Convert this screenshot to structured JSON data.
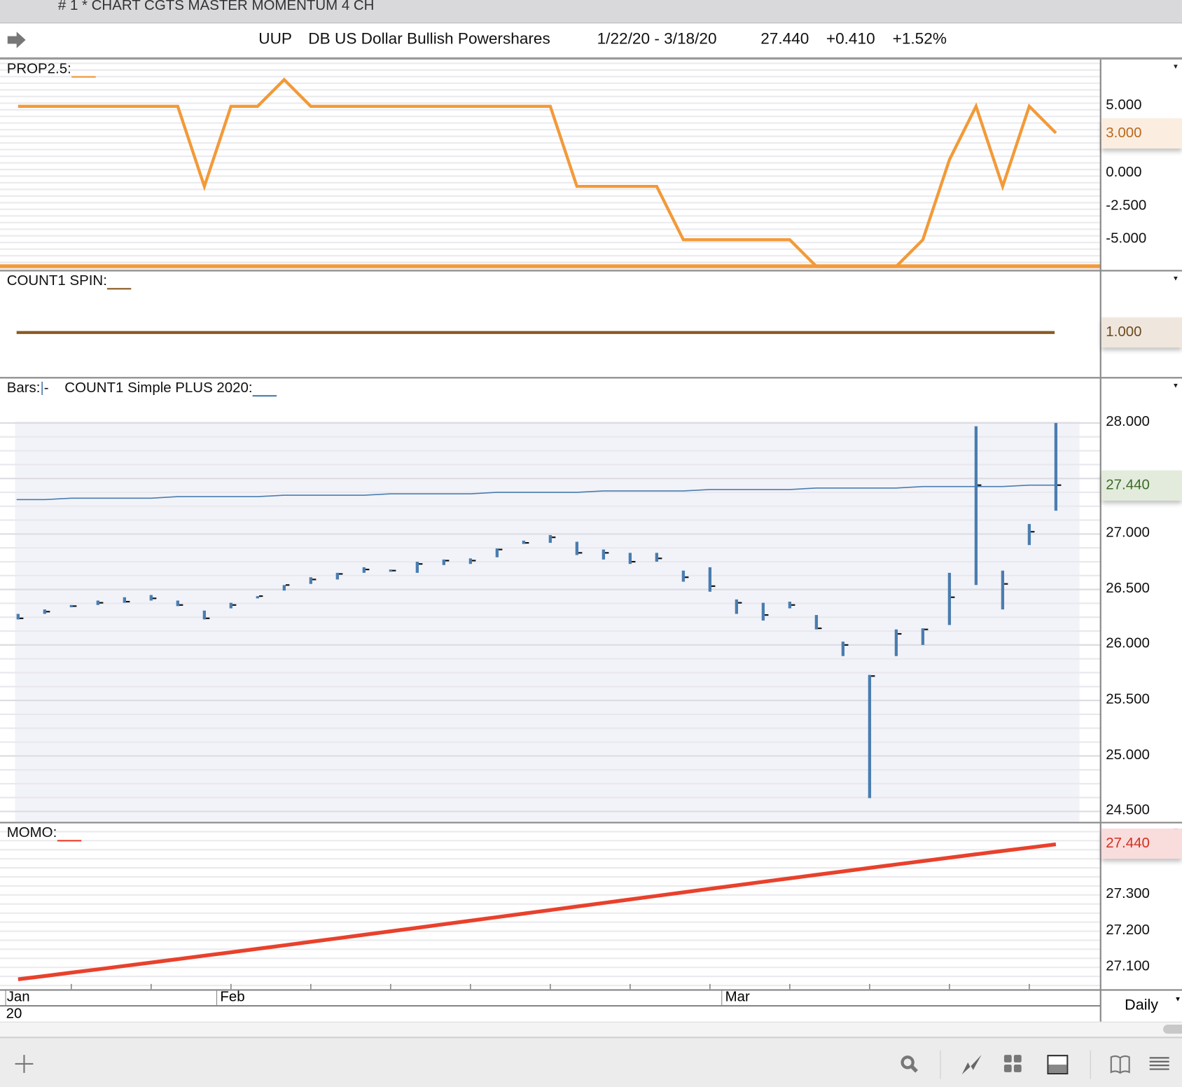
{
  "window_title": "# 1 * CHART CGTS MASTER MOMENTUM 4 CH",
  "header": {
    "symbol": "UUP",
    "name": "DB US Dollar Bullish Powershares",
    "date_range": "1/22/20 - 3/18/20",
    "last": "27.440",
    "change": "+0.410",
    "change_pct": "+1.52%"
  },
  "colors": {
    "prop": "#f29a38",
    "spin": "#8a5a25",
    "bars": "#4a7db0",
    "ma": "#4a7db0",
    "momo": "#e8412c"
  },
  "panels": {
    "prop": {
      "label": "PROP2.5:",
      "current": "3.000"
    },
    "spin": {
      "label": "COUNT1 SPIN:",
      "current": "1.000"
    },
    "bars": {
      "label": "Bars:",
      "label2": "COUNT1 Simple PLUS 2020:",
      "current": "27.440"
    },
    "momo": {
      "label": "MOMO:",
      "current": "27.440"
    }
  },
  "xaxis": {
    "months": [
      "Jan",
      "Feb",
      "Mar"
    ],
    "year": "20",
    "period": "Daily"
  },
  "chart_data": [
    {
      "type": "line",
      "title": "PROP2.5",
      "yticks": [
        "5.000",
        "0.000",
        "-2.500",
        "-5.000"
      ],
      "ytick_values": [
        5,
        0,
        -2.5,
        -5
      ],
      "ylim": [
        -7,
        8.4
      ],
      "values": [
        5,
        5,
        5,
        5,
        5,
        5,
        5,
        -1,
        5,
        5,
        7,
        5,
        5,
        5,
        5,
        5,
        5,
        5,
        5,
        5,
        5,
        -1,
        -1,
        -1,
        -1,
        -5,
        -5,
        -5,
        -5,
        -5,
        -7,
        -7,
        -7,
        -7,
        -5,
        1,
        5,
        -1,
        5,
        3
      ]
    },
    {
      "type": "line",
      "title": "COUNT1 SPIN",
      "values_constant": 1.0,
      "count": 40
    },
    {
      "type": "ohlc",
      "title": "UUP Daily Bars",
      "yticks": [
        "28.000",
        "27.000",
        "26.500",
        "26.000",
        "25.500",
        "25.000",
        "24.500"
      ],
      "ytick_values": [
        28,
        27,
        26.5,
        26,
        25.5,
        25,
        24.5
      ],
      "ylim": [
        24.45,
        28.4
      ],
      "high": [
        26.28,
        26.32,
        26.36,
        26.4,
        26.43,
        26.45,
        26.4,
        26.31,
        26.38,
        26.44,
        26.54,
        26.61,
        26.65,
        26.7,
        26.68,
        26.75,
        26.77,
        26.78,
        26.87,
        26.94,
        26.99,
        26.93,
        26.86,
        26.83,
        26.83,
        26.67,
        26.7,
        26.41,
        26.38,
        26.39,
        26.27,
        26.03,
        25.73,
        26.14,
        26.15,
        26.65,
        27.97,
        26.67,
        27.09,
        28.0
      ],
      "low": [
        26.23,
        26.28,
        26.34,
        26.36,
        26.38,
        26.4,
        26.35,
        26.23,
        26.33,
        26.43,
        26.49,
        26.55,
        26.59,
        26.65,
        26.66,
        26.65,
        26.72,
        26.73,
        26.79,
        26.91,
        26.92,
        26.81,
        26.77,
        26.73,
        26.75,
        26.57,
        26.48,
        26.28,
        26.22,
        26.33,
        26.14,
        25.9,
        24.62,
        25.9,
        26.0,
        26.18,
        26.54,
        26.32,
        26.9,
        27.21
      ],
      "close": [
        26.24,
        26.3,
        26.35,
        26.38,
        26.39,
        26.42,
        26.36,
        26.24,
        26.36,
        26.44,
        26.54,
        26.59,
        26.64,
        26.68,
        26.67,
        26.73,
        26.76,
        26.76,
        26.86,
        26.92,
        26.97,
        26.83,
        26.83,
        26.75,
        26.78,
        26.61,
        26.53,
        26.38,
        26.27,
        26.36,
        26.15,
        26.0,
        25.72,
        26.1,
        26.14,
        26.43,
        27.44,
        26.55,
        27.02,
        27.44
      ],
      "ma_series": {
        "name": "COUNT1 Simple PLUS 2020",
        "start": 27.31,
        "end": 27.44
      }
    },
    {
      "type": "line",
      "title": "MOMO",
      "yticks": [
        "27.300",
        "27.200",
        "27.100"
      ],
      "ytick_values": [
        27.3,
        27.2,
        27.1
      ],
      "ylim": [
        27.045,
        27.5
      ],
      "start": 27.067,
      "end": 27.44,
      "count": 40
    }
  ]
}
